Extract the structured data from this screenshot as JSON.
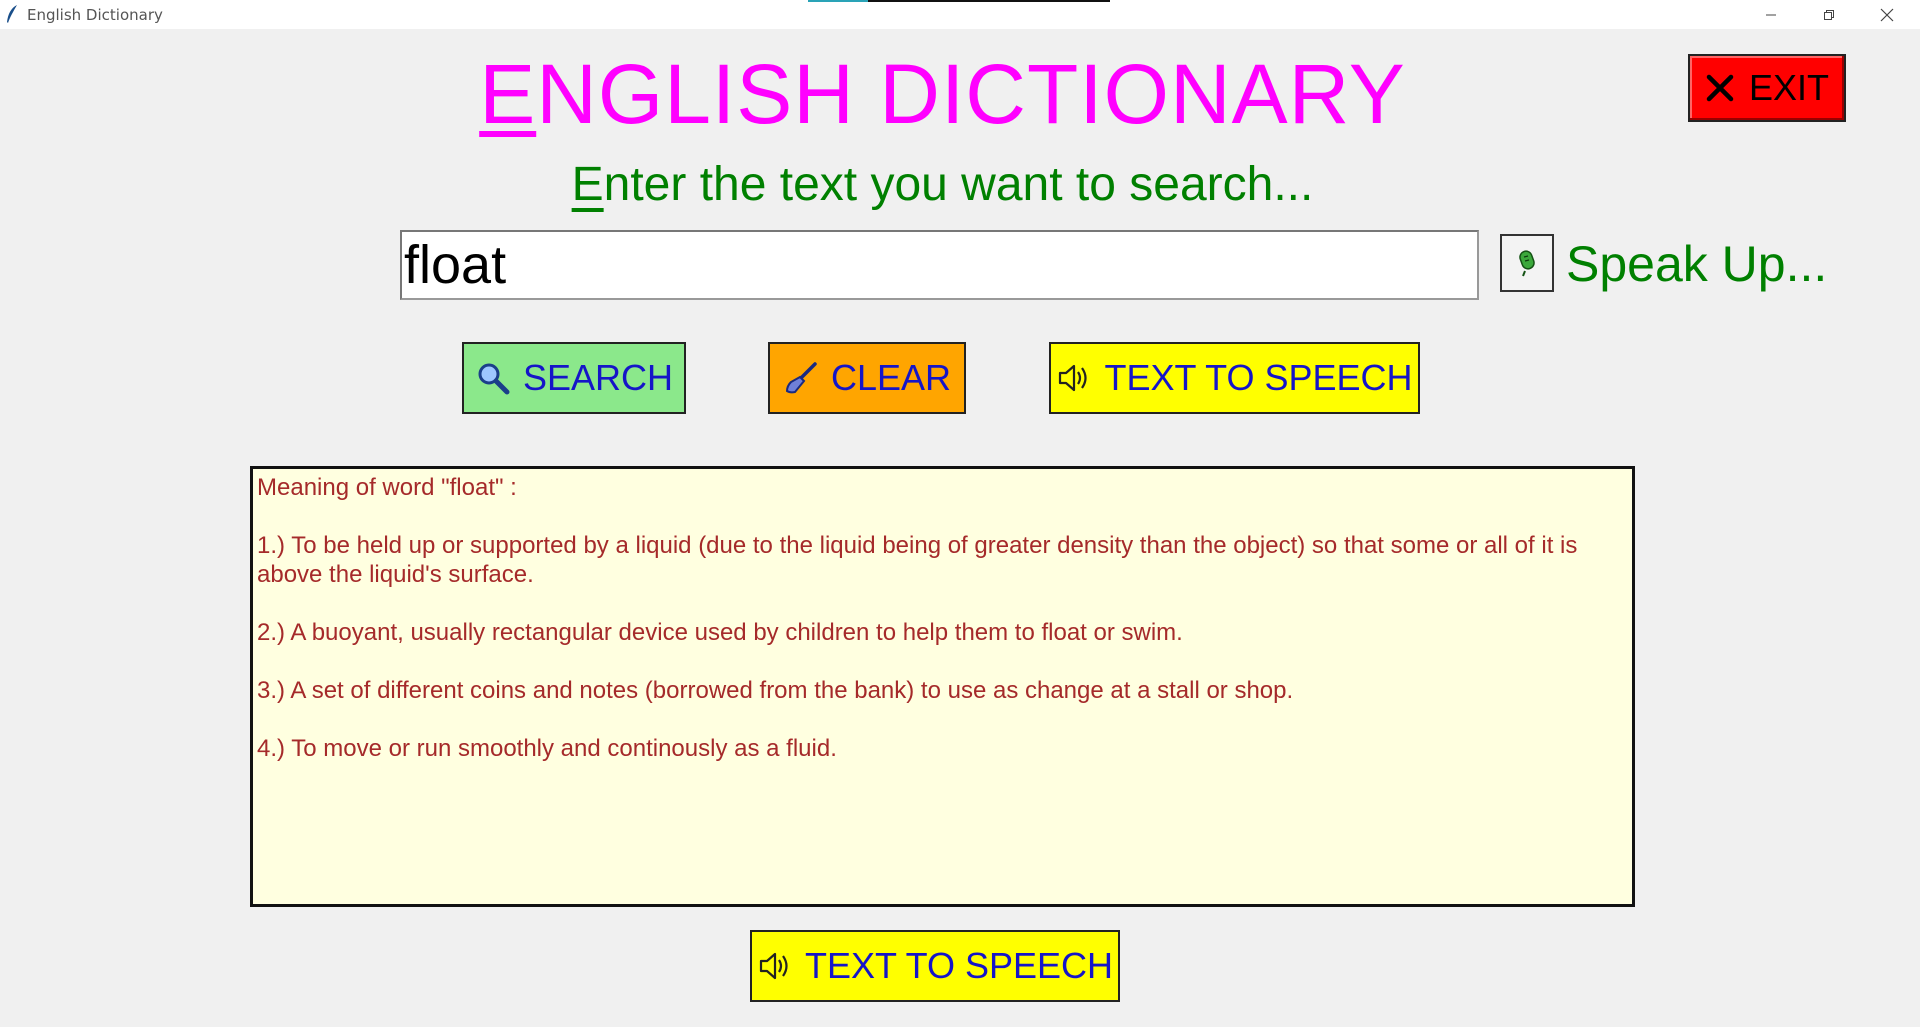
{
  "window": {
    "title": "English Dictionary",
    "controls": [
      "minimize",
      "restore",
      "close"
    ]
  },
  "header": {
    "title_first": "E",
    "title_rest": "NGLISH DICTIONARY",
    "exit_label": "EXIT"
  },
  "search": {
    "prompt_first": "E",
    "prompt_rest": "nter the text you want to search...",
    "value": "float",
    "speak_label": "Speak Up..."
  },
  "buttons": {
    "search_label": "SEARCH",
    "clear_label": "CLEAR",
    "tts_label": "TEXT TO SPEECH",
    "tts_bottom_label": "TEXT TO SPEECH"
  },
  "meaning": {
    "heading": "Meaning of word \"float\" :",
    "items": [
      "1.) To be held up or supported by a liquid (due to the liquid being of greater density than the object) so that some or all of it is above the liquid's surface.",
      "2.) A buoyant, usually rectangular device used by children to help them to float or swim.",
      "3.) A set of different coins and notes (borrowed from the bank) to use as change at a stall or shop.",
      "4.) To move or run smoothly and continously as a fluid."
    ]
  },
  "colors": {
    "title": "#ff00ff",
    "prompt": "#008000",
    "exit_bg": "#ff0000",
    "search_bg": "#8be88b",
    "clear_bg": "#ffa500",
    "tts_bg": "#ffff00",
    "button_text": "#1515c8",
    "meaning_bg": "#ffffe0",
    "meaning_text": "#a52a2a"
  },
  "icons": {
    "app": "feather-icon",
    "exit": "close-x-icon",
    "mic": "microphone-icon",
    "search": "magnifier-icon",
    "clear": "broom-icon",
    "tts": "speaker-icon"
  }
}
